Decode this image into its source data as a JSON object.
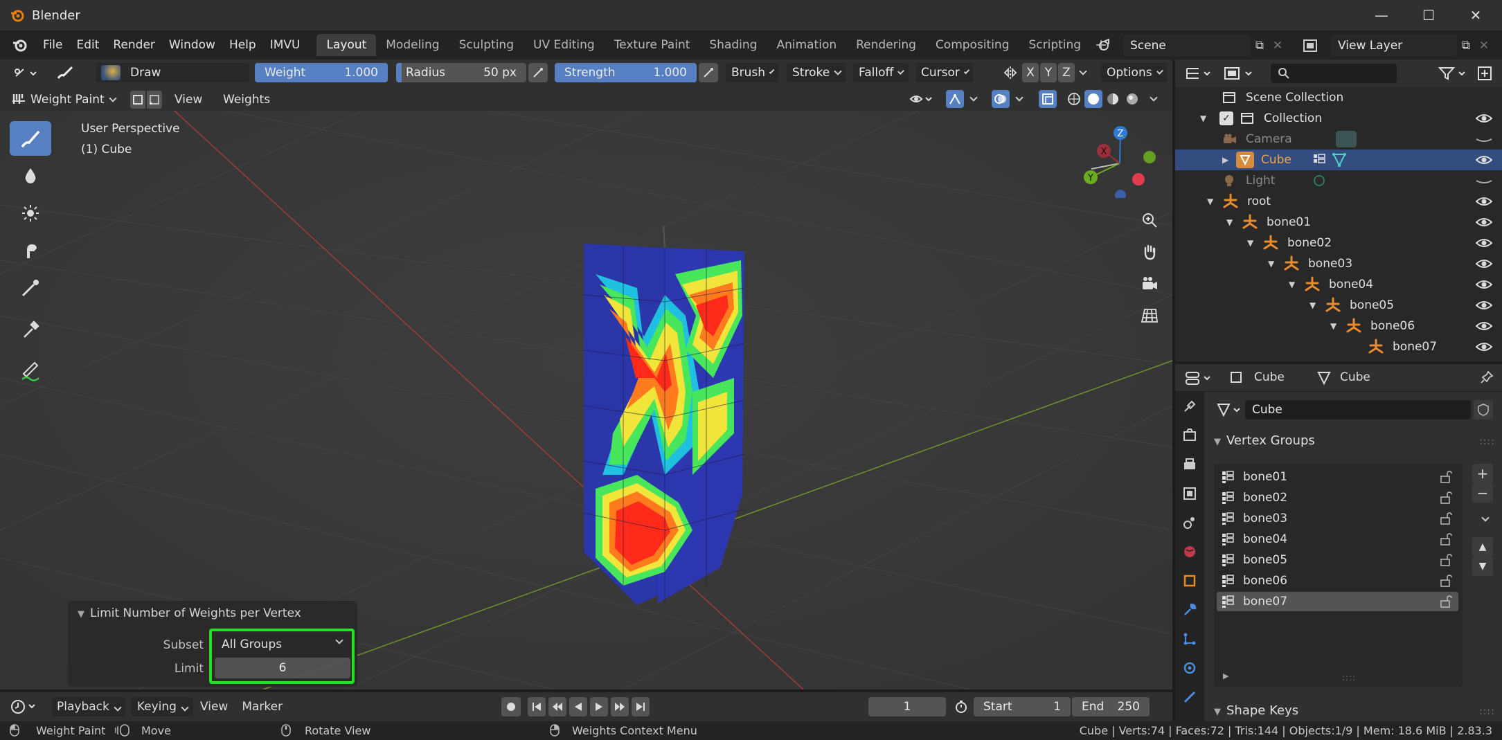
{
  "window": {
    "title": "Blender",
    "min": "—",
    "max": "☐",
    "close": "✕"
  },
  "menu": {
    "items": [
      "File",
      "Edit",
      "Render",
      "Window",
      "Help",
      "IMVU"
    ]
  },
  "workspaces": [
    "Layout",
    "Modeling",
    "Sculpting",
    "UV Editing",
    "Texture Paint",
    "Shading",
    "Animation",
    "Rendering",
    "Compositing",
    "Scripting"
  ],
  "active_workspace": "Layout",
  "scene": {
    "name": "Scene",
    "view_layer": "View Layer"
  },
  "tool_header": {
    "brush": "Draw",
    "weight_label": "Weight",
    "weight_value": "1.000",
    "radius_label": "Radius",
    "radius_value": "50 px",
    "strength_label": "Strength",
    "strength_value": "1.000",
    "brush_menu": "Brush",
    "stroke_menu": "Stroke",
    "falloff_menu": "Falloff",
    "cursor_menu": "Cursor",
    "axis_x": "X",
    "axis_y": "Y",
    "axis_z": "Z",
    "options_menu": "Options"
  },
  "mode_header": {
    "mode": "Weight Paint",
    "view": "View",
    "weights": "Weights"
  },
  "viewport": {
    "perspective": "User Perspective",
    "object": "(1) Cube",
    "gizmo": {
      "x": "X",
      "y": "Y",
      "z": "Z"
    }
  },
  "redo_panel": {
    "title": "Limit Number of Weights per Vertex",
    "subset_label": "Subset",
    "subset_value": "All Groups",
    "limit_label": "Limit",
    "limit_value": "6"
  },
  "timeline": {
    "playback": "Playback",
    "keying": "Keying",
    "view": "View",
    "marker": "Marker",
    "current_frame": "1",
    "start_label": "Start",
    "start_value": "1",
    "end_label": "End",
    "end_value": "250"
  },
  "statusbar": {
    "left": "Weight Paint",
    "move": "Move",
    "rotate": "Rotate View",
    "context": "Weights Context Menu",
    "stats": "Cube | Verts:74 | Faces:72 | Tris:144 | Objects:1/9 | Mem: 18.6 MiB | 2.83.3"
  },
  "outliner": {
    "root": "Scene Collection",
    "rows": [
      {
        "label": "Collection"
      },
      {
        "label": "Camera"
      },
      {
        "label": "Cube"
      },
      {
        "label": "Light"
      },
      {
        "label": "root"
      },
      {
        "label": "bone01"
      },
      {
        "label": "bone02"
      },
      {
        "label": "bone03"
      },
      {
        "label": "bone04"
      },
      {
        "label": "bone05"
      },
      {
        "label": "bone06"
      },
      {
        "label": "bone07"
      }
    ]
  },
  "properties": {
    "object": "Cube",
    "data": "Cube",
    "mesh_name": "Cube",
    "vertex_groups_title": "Vertex Groups",
    "vertex_groups": [
      "bone01",
      "bone02",
      "bone03",
      "bone04",
      "bone05",
      "bone06",
      "bone07"
    ],
    "active_group": "bone07",
    "shape_keys_title": "Shape Keys"
  },
  "colors": {
    "accent": "#5680c2",
    "highlight": "#23e823",
    "selected_row": "#334d80",
    "object_orange": "#f0a046"
  }
}
